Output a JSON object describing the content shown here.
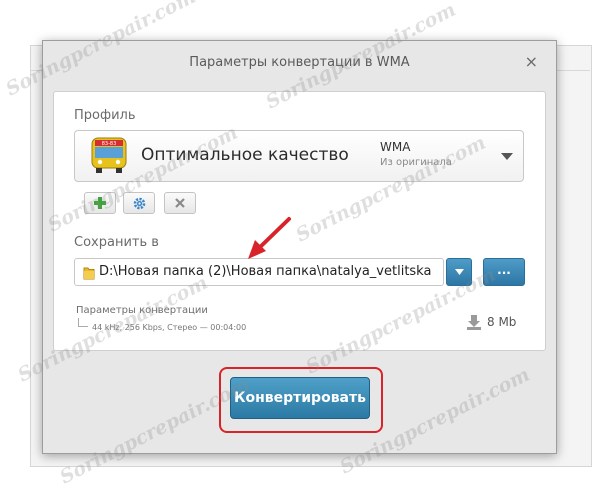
{
  "dialog": {
    "title": "Параметры конвертации в WMA",
    "close_label": "×"
  },
  "profile": {
    "label": "Профиль",
    "name": "Оптимальное качество",
    "format": "WMA",
    "format_sub": "Из оригинала",
    "icon": "bus-icon",
    "buttons": [
      "add-icon",
      "gear-icon",
      "close-icon"
    ]
  },
  "save": {
    "label": "Сохранить в",
    "path": "D:\\Новая папка (2)\\Новая папка\\natalya_vetlitska",
    "browse_label": "..."
  },
  "conversion": {
    "label": "Параметры конвертации",
    "details": "44 kHz, 256 Kbps, Стерео — 00:04:00",
    "size": "8 Mb"
  },
  "convert_button": "Конвертировать",
  "watermark": "Soringpcrepair.com",
  "colors": {
    "accent": "#2d7aa6",
    "highlight": "#d9232a",
    "plus": "#3aa635",
    "gear": "#3a86c8"
  }
}
